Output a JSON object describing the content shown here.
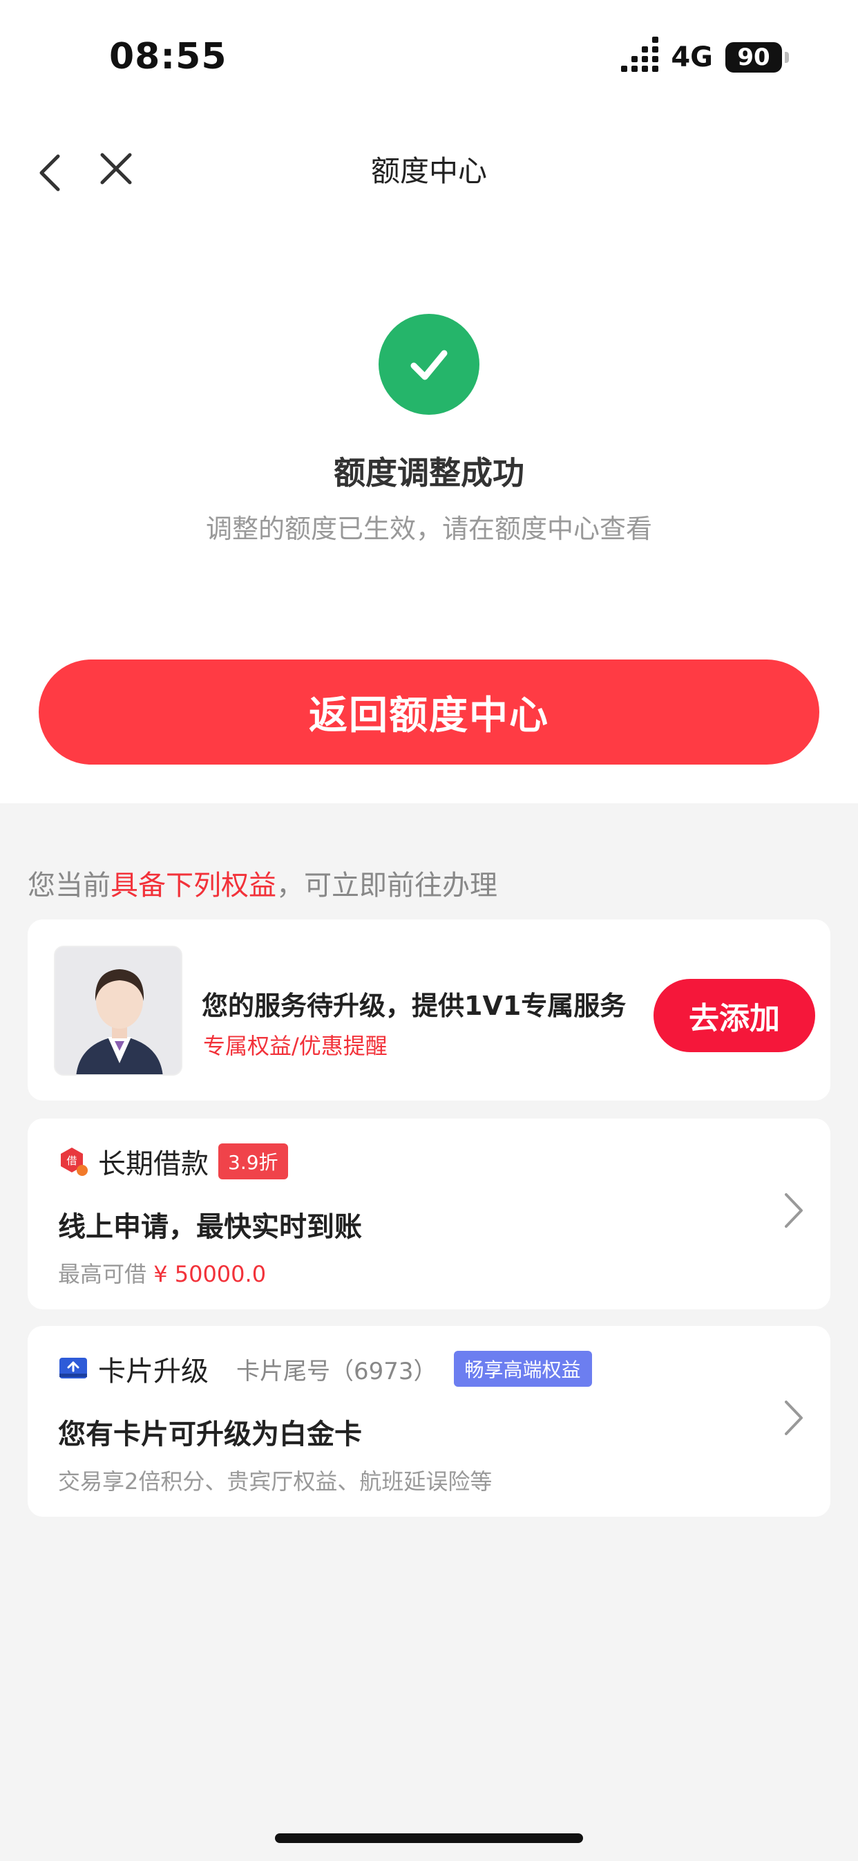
{
  "status_bar": {
    "time": "08:55",
    "network": "4G",
    "battery": "90"
  },
  "nav": {
    "title": "额度中心"
  },
  "success": {
    "icon": "check-icon",
    "title": "额度调整成功",
    "subtitle": "调整的额度已生效，请在额度中心查看"
  },
  "return_button": "返回额度中心",
  "benefits": {
    "heading_prefix": "您当前",
    "heading_highlight": "具备下列权益",
    "heading_suffix": "，可立即前往办理"
  },
  "service_card": {
    "title": "您的服务待升级，提供1V1专属服务",
    "subtitle": "专属权益/优惠提醒",
    "button": "去添加"
  },
  "loan_card": {
    "icon": "loan-badge-icon",
    "icon_text": "借",
    "name": "长期借款",
    "tag": "3.9折",
    "line1": "线上申请，最快实时到账",
    "line2_prefix": "最高可借 ",
    "amount": "¥ 50000.0"
  },
  "upgrade_card": {
    "icon": "card-upgrade-icon",
    "name": "卡片升级",
    "tail": "卡片尾号（6973）",
    "tag": "畅享高端权益",
    "line1": "您有卡片可升级为白金卡",
    "line2": "交易享2倍积分、贵宾厅权益、航班延误险等"
  },
  "colors": {
    "accent_red": "#ff3b44",
    "success_green": "#25b56a",
    "tag_blue": "#6c7ef0"
  }
}
